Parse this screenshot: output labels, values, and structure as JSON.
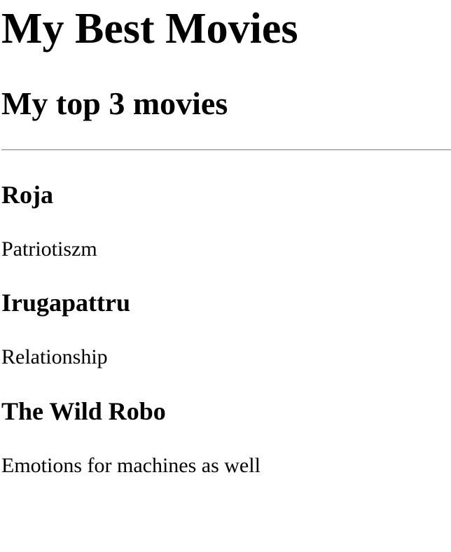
{
  "page": {
    "title": "My Best Movies",
    "subtitle": "My top 3 movies"
  },
  "movies": [
    {
      "title": "Roja",
      "description": "Patriotiszm"
    },
    {
      "title": "Irugapattru",
      "description": "Relationship"
    },
    {
      "title": "The Wild Robo",
      "description": "Emotions for machines as well"
    }
  ]
}
